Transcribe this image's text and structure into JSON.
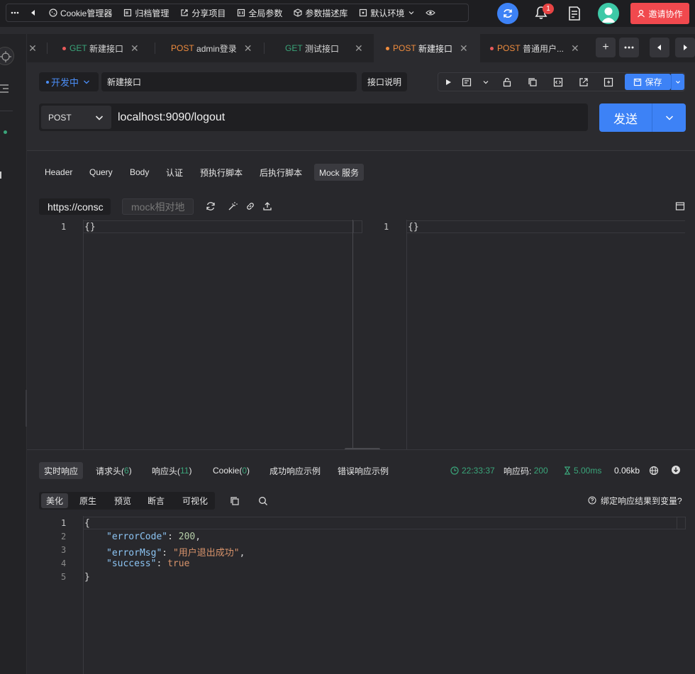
{
  "toolbar": {
    "items": [
      "Cookie管理器",
      "归档管理",
      "分享项目",
      "全局参数",
      "参数描述库",
      "默认环境"
    ],
    "notification_count": "1",
    "invite_label": "邀请协作"
  },
  "tabs": [
    {
      "method": "GET",
      "label": "新建接口"
    },
    {
      "method": "POST",
      "label": "admin登录"
    },
    {
      "method": "GET",
      "label": "测试接口"
    },
    {
      "method": "POST",
      "label": "新建接口"
    },
    {
      "method": "POST",
      "label": "普通用户..."
    }
  ],
  "request": {
    "env_label": "开发中",
    "name": "新建接口",
    "desc_button": "接口说明",
    "save_label": "保存",
    "method": "POST",
    "url": "localhost:9090/logout",
    "send_label": "发送"
  },
  "req_tabs": [
    "Header",
    "Query",
    "Body",
    "认证",
    "预执行脚本",
    "后执行脚本",
    "Mock 服务"
  ],
  "mock": {
    "url_value": "https://consc",
    "path_placeholder": "mock相对地",
    "left_line": "1",
    "left_code": "{}",
    "right_line": "1",
    "right_code": "{}"
  },
  "response": {
    "tabs": {
      "realtime": "实时响应",
      "req_headers": "请求头(",
      "req_headers_count": "6",
      "resp_headers": "响应头(",
      "resp_headers_count": "11",
      "cookie": "Cookie(",
      "cookie_count": "0",
      "close_paren": ")",
      "success_example": "成功响应示例",
      "error_example": "错误响应示例"
    },
    "time": "22:33:37",
    "status_label": "响应码:",
    "status_code": "200",
    "duration": "5.00ms",
    "size": "0.06kb",
    "sub_tabs": [
      "美化",
      "原生",
      "预览",
      "断言",
      "可视化"
    ],
    "bind_var": "绑定响应结果到变量?",
    "lines": [
      "1",
      "2",
      "3",
      "4",
      "5"
    ],
    "body": {
      "open": "{",
      "k1": "\"errorCode\"",
      "v1": "200",
      "k2": "\"errorMsg\"",
      "v2": "\"用户退出成功\"",
      "k3": "\"success\"",
      "v3": "true",
      "close": "}"
    }
  },
  "colors": {
    "accent": "#3d82f6",
    "get": "#3aa57a",
    "post": "#f08c3e",
    "invite": "#f1494e"
  }
}
